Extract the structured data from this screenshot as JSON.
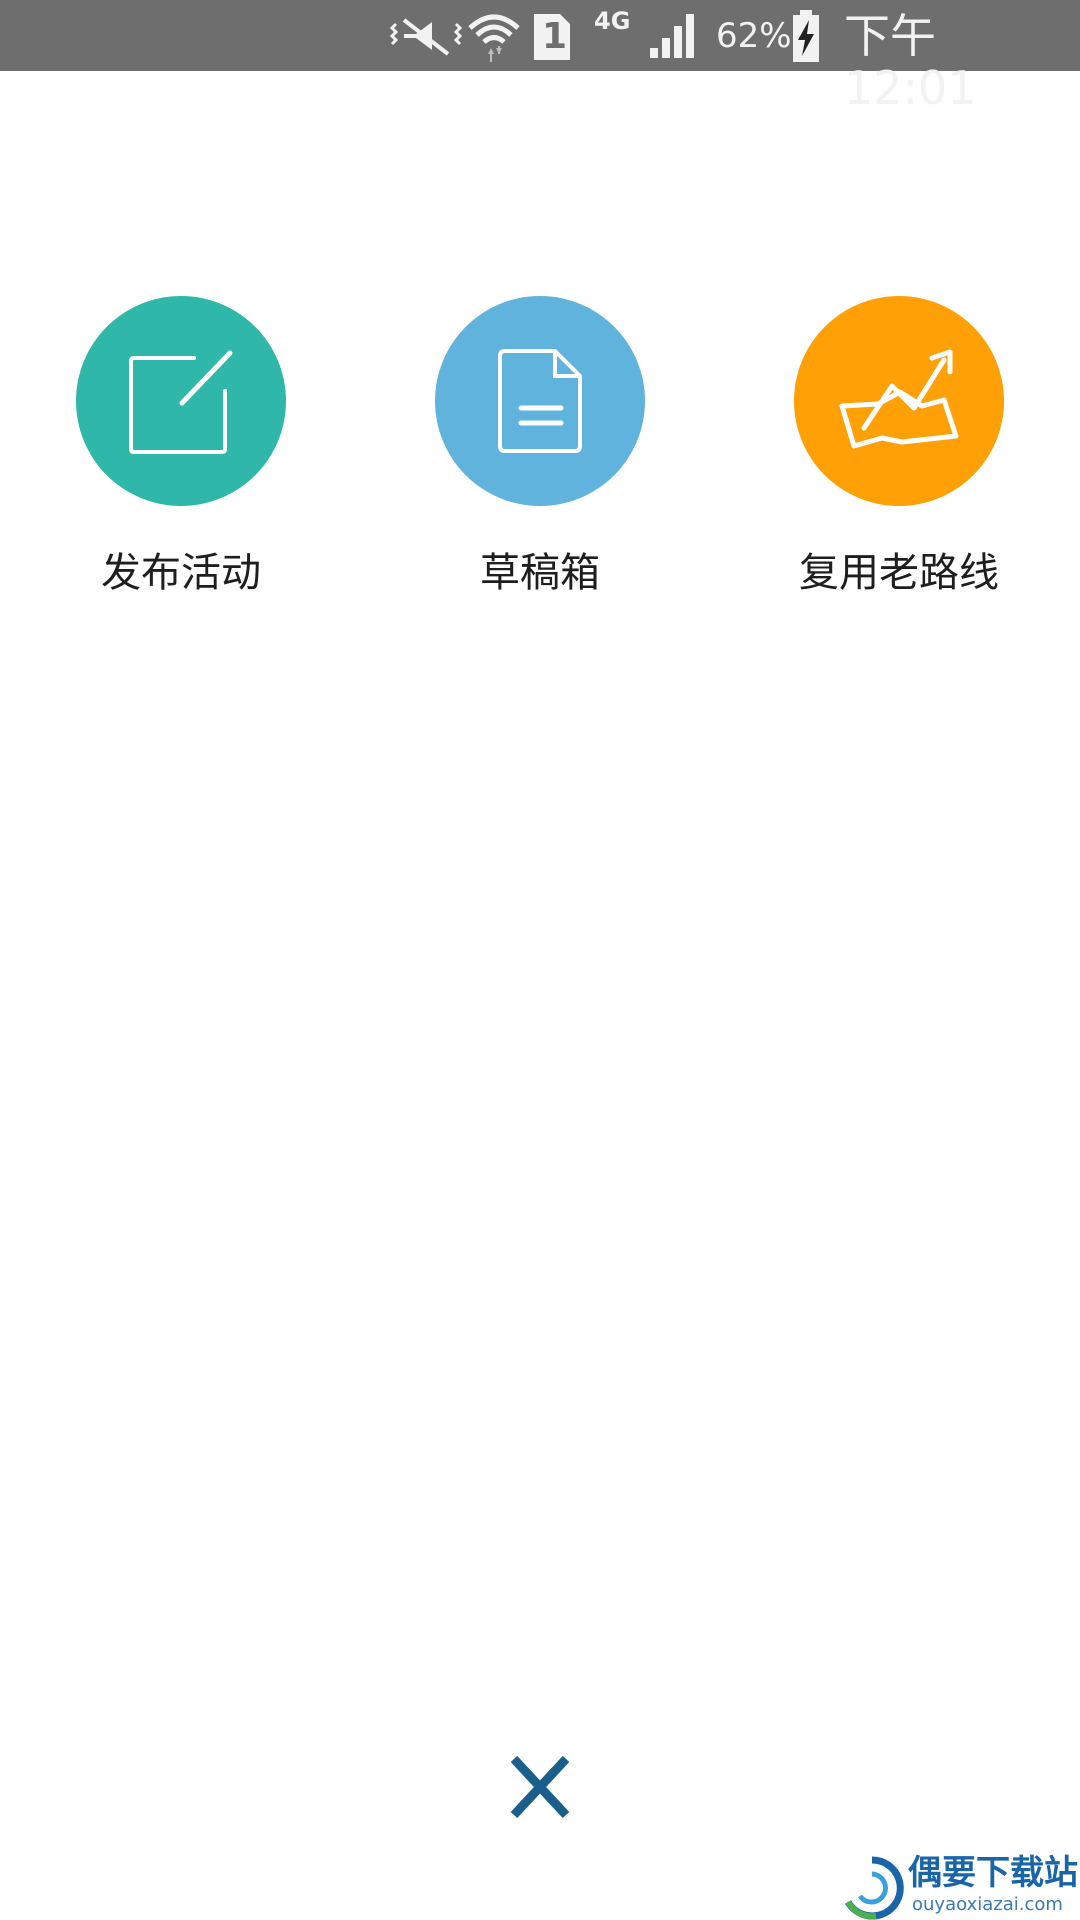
{
  "status_bar": {
    "network_type": "4G",
    "battery_percent": "62%",
    "time": "下午 12:01",
    "sim_slot": "1",
    "icons": [
      "vibrate-mute-icon",
      "wifi-icon",
      "sim-card-icon",
      "signal-icon",
      "battery-charging-icon"
    ]
  },
  "actions": [
    {
      "label": "发布活动",
      "icon": "edit-icon",
      "color": "#2fb8aa"
    },
    {
      "label": "草稿箱",
      "icon": "document-icon",
      "color": "#5fb3dc"
    },
    {
      "label": "复用老路线",
      "icon": "route-map-icon",
      "color": "#fea006"
    }
  ],
  "close": {
    "icon": "close-icon",
    "color": "#1a5e8c"
  },
  "watermark": {
    "title": "偶要下载站",
    "url": "ouyaoxiazai.com"
  }
}
